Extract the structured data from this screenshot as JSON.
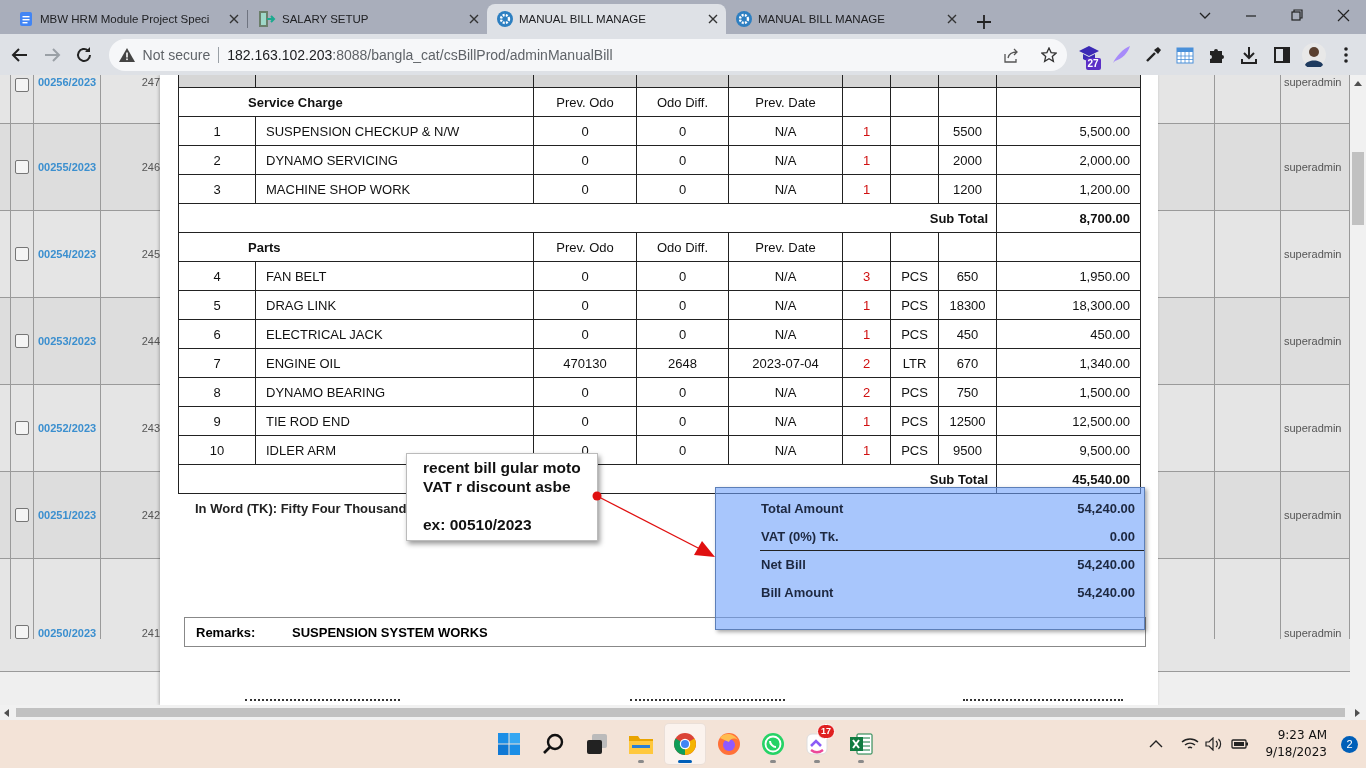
{
  "browser": {
    "tabs": [
      {
        "title": "MBW HRM Module Project Speci",
        "selected": false
      },
      {
        "title": "SALARY SETUP",
        "selected": false
      },
      {
        "title": "MANUAL BILL MANAGE",
        "selected": true
      },
      {
        "title": "MANUAL BILL MANAGE",
        "selected": false
      }
    ],
    "security": "Not secure",
    "url_host": "182.163.102.203",
    "url_path": ":8088/bangla_cat/csBillProd/adminManualBill",
    "extension_badge": "27"
  },
  "bill_list": {
    "rows": [
      {
        "checked": false,
        "bill_no": "00256/2023",
        "serial": "247",
        "user": "superadmin"
      },
      {
        "checked": false,
        "bill_no": "00255/2023",
        "serial": "246",
        "user": "superadmin"
      },
      {
        "checked": false,
        "bill_no": "00254/2023",
        "serial": "245",
        "user": "superadmin"
      },
      {
        "checked": false,
        "bill_no": "00253/2023",
        "serial": "244",
        "user": "superadmin"
      },
      {
        "checked": false,
        "bill_no": "00252/2023",
        "serial": "243",
        "user": "superadmin"
      },
      {
        "checked": false,
        "bill_no": "00251/2023",
        "serial": "242",
        "user": "superadmin"
      },
      {
        "checked": false,
        "bill_no": "00250/2023",
        "serial": "241",
        "user": "superadmin"
      }
    ]
  },
  "bill": {
    "sections": [
      {
        "title": "Service Charge",
        "columns": [
          "Prev. Odo",
          "Odo Diff.",
          "Prev. Date"
        ],
        "subtotal_label": "Sub Total",
        "subtotal": "8,700.00",
        "items": [
          {
            "no": "1",
            "description": "SUSPENSION CHECKUP & N/W",
            "prev_odo": "0",
            "odo_diff": "0",
            "prev_date": "N/A",
            "qty": "1",
            "rate": "5500",
            "amount": "5,500.00"
          },
          {
            "no": "2",
            "description": "DYNAMO SERVICING",
            "prev_odo": "0",
            "odo_diff": "0",
            "prev_date": "N/A",
            "qty": "1",
            "rate": "2000",
            "amount": "2,000.00"
          },
          {
            "no": "3",
            "description": "MACHINE SHOP WORK",
            "prev_odo": "0",
            "odo_diff": "0",
            "prev_date": "N/A",
            "qty": "1",
            "rate": "1200",
            "amount": "1,200.00"
          }
        ]
      },
      {
        "title": "Parts",
        "columns": [
          "Prev. Odo",
          "Odo Diff.",
          "Prev. Date"
        ],
        "subtotal_label": "Sub Total",
        "subtotal": "45,540.00",
        "items": [
          {
            "no": "4",
            "description": "FAN BELT",
            "prev_odo": "0",
            "odo_diff": "0",
            "prev_date": "N/A",
            "qty": "3",
            "unit": "PCS",
            "rate": "650",
            "amount": "1,950.00"
          },
          {
            "no": "5",
            "description": "DRAG LINK",
            "prev_odo": "0",
            "odo_diff": "0",
            "prev_date": "N/A",
            "qty": "1",
            "unit": "PCS",
            "rate": "18300",
            "amount": "18,300.00"
          },
          {
            "no": "6",
            "description": "ELECTRICAL JACK",
            "prev_odo": "0",
            "odo_diff": "0",
            "prev_date": "N/A",
            "qty": "1",
            "unit": "PCS",
            "rate": "450",
            "amount": "450.00"
          },
          {
            "no": "7",
            "description": "ENGINE OIL",
            "prev_odo": "470130",
            "odo_diff": "2648",
            "prev_date": "2023-07-04",
            "qty": "2",
            "unit": "LTR",
            "rate": "670",
            "amount": "1,340.00"
          },
          {
            "no": "8",
            "description": "DYNAMO BEARING",
            "prev_odo": "0",
            "odo_diff": "0",
            "prev_date": "N/A",
            "qty": "2",
            "unit": "PCS",
            "rate": "750",
            "amount": "1,500.00"
          },
          {
            "no": "9",
            "description": "TIE ROD END",
            "prev_odo": "0",
            "odo_diff": "0",
            "prev_date": "N/A",
            "qty": "1",
            "unit": "PCS",
            "rate": "12500",
            "amount": "12,500.00"
          },
          {
            "no": "10",
            "description": "IDLER ARM",
            "prev_odo": "0",
            "odo_diff": "0",
            "prev_date": "N/A",
            "qty": "1",
            "unit": "PCS",
            "rate": "9500",
            "amount": "9,500.00"
          }
        ]
      }
    ],
    "in_word": "In Word (TK): Fifty Four Thousand",
    "summary": [
      {
        "label": "Total Amount",
        "value": "54,240.00",
        "divider_before": false
      },
      {
        "label": "VAT (0%) Tk.",
        "value": "0.00",
        "divider_before": false
      },
      {
        "label": "Net Bill",
        "value": "54,240.00",
        "divider_before": true
      },
      {
        "label": "Bill Amount",
        "value": "54,240.00",
        "divider_before": false
      }
    ],
    "remarks": {
      "label": "Remarks:",
      "value": "SUSPENSION SYSTEM WORKS"
    }
  },
  "note": {
    "lines": [
      "recent bill gular moto",
      "VAT r discount asbe",
      "ex: 00510/2023"
    ]
  },
  "taskbar": {
    "apps": [
      {
        "kind": "start",
        "running": false,
        "selected": false
      },
      {
        "kind": "search",
        "running": false,
        "selected": false
      },
      {
        "kind": "taskview",
        "running": false,
        "selected": false
      },
      {
        "kind": "folder",
        "running": true,
        "selected": false
      },
      {
        "kind": "chrome",
        "running": true,
        "selected": true
      },
      {
        "kind": "firefox",
        "running": false,
        "selected": false
      },
      {
        "kind": "whatsapp",
        "running": true,
        "selected": false
      },
      {
        "kind": "checklist",
        "running": true,
        "selected": false,
        "badge": "17"
      },
      {
        "kind": "excel",
        "running": true,
        "selected": false
      }
    ],
    "time": "9:23 AM",
    "date": "9/18/2023",
    "notifications": "2"
  }
}
